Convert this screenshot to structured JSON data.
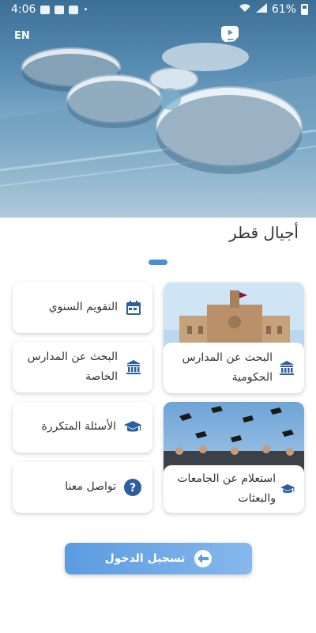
{
  "status_bar": {
    "time": "4:06",
    "battery": "61%"
  },
  "header": {
    "lang_toggle": "EN"
  },
  "app_title": "أجيال قطر",
  "cards": {
    "calendar": "التقويم السنوي",
    "private_schools": "البحث عن المدارس الخاصة",
    "faq": "الأسئلة المتكررة",
    "contact": "تواصل معنا",
    "public_schools": "البحث عن المدارس الحكومية",
    "universities": "استعلام عن الجامعات والبعثات"
  },
  "login_label": "تسجيل الدخول",
  "colors": {
    "accent": "#4a8fd6",
    "icon": "#2c5f9e"
  }
}
